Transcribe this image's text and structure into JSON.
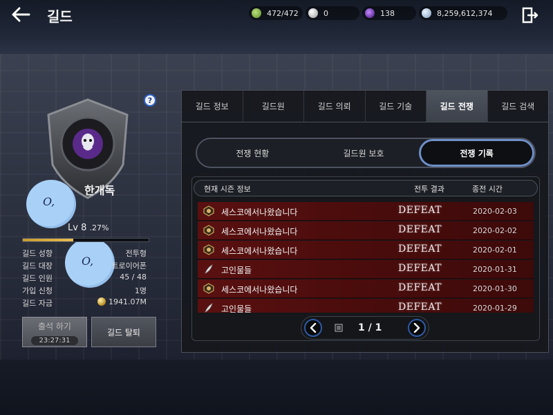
{
  "header": {
    "title": "길드",
    "currencies": [
      {
        "name": "stamina",
        "value": "472/472",
        "icon": "clover-icon",
        "color": "#7fae4a"
      },
      {
        "name": "pearl",
        "value": "0",
        "icon": "pearl-icon",
        "color": "#e0e0e0"
      },
      {
        "name": "dark-orb",
        "value": "138",
        "icon": "orb-icon",
        "color": "#7a2fc9"
      },
      {
        "name": "silver",
        "value": "8,259,612,374",
        "icon": "silver-coin-icon",
        "color": "#bcd3ea"
      }
    ]
  },
  "guild": {
    "name": "한개독",
    "level": "Lv 8",
    "exp_percent": ".27%",
    "exp_fill": 0.27,
    "info": [
      {
        "label": "길드 성향",
        "value": "전투형"
      },
      {
        "label": "길드 대장",
        "value": "트로이어폰"
      },
      {
        "label": "길드 인원",
        "value": "45 / 48"
      },
      {
        "label": "가입 신청",
        "value": "1명"
      },
      {
        "label": "길드 자금",
        "value": "1941.07M"
      }
    ],
    "attend_label": "출석 하기",
    "attend_timer": "23:27:31",
    "leave_label": "길드 탈퇴",
    "help_label": "?"
  },
  "tabs": [
    {
      "label": "길드 정보",
      "active": false
    },
    {
      "label": "길드원",
      "active": false
    },
    {
      "label": "길드 의뢰",
      "active": false
    },
    {
      "label": "길드 기술",
      "active": false
    },
    {
      "label": "길드 전쟁",
      "active": true
    },
    {
      "label": "길드 검색",
      "active": false
    }
  ],
  "subtabs": [
    {
      "label": "전쟁 현황",
      "active": false
    },
    {
      "label": "길드원 보호",
      "active": false
    },
    {
      "label": "전쟁 기록",
      "active": true
    }
  ],
  "list": {
    "columns": {
      "season": "현재 시즌 정보",
      "result": "전투 결과",
      "time": "종전 시간"
    },
    "rows": [
      {
        "guild": "세스코에서나왔습니다",
        "result": "DEFEAT",
        "date": "2020-02-03",
        "icon": "guild-crest-icon"
      },
      {
        "guild": "세스코에서나왔습니다",
        "result": "DEFEAT",
        "date": "2020-02-02",
        "icon": "guild-crest-icon"
      },
      {
        "guild": "세스코에서나왔습니다",
        "result": "DEFEAT",
        "date": "2020-02-01",
        "icon": "guild-crest-icon"
      },
      {
        "guild": "고인물들",
        "result": "DEFEAT",
        "date": "2020-01-31",
        "icon": "feather-crest-icon"
      },
      {
        "guild": "세스코에서나왔습니다",
        "result": "DEFEAT",
        "date": "2020-01-30",
        "icon": "guild-crest-icon"
      },
      {
        "guild": "고인물들",
        "result": "DEFEAT",
        "date": "2020-01-29",
        "icon": "feather-crest-icon"
      }
    ]
  },
  "pager": {
    "text": "1 / 1"
  }
}
